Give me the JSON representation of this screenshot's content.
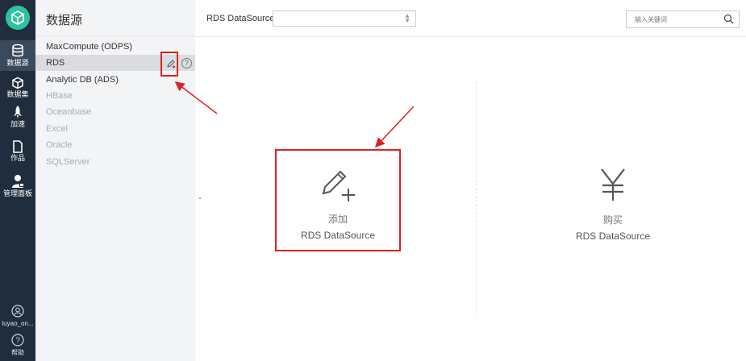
{
  "rail": {
    "items": [
      {
        "label": "数据源",
        "icon": "database-icon",
        "active": true
      },
      {
        "label": "数据集",
        "icon": "cube-icon"
      },
      {
        "label": "加速",
        "icon": "rocket-icon"
      },
      {
        "label": "作品",
        "icon": "document-icon"
      },
      {
        "label": "管理面板",
        "icon": "admin-user-icon"
      }
    ],
    "user": "luyao_on...",
    "help": "帮助"
  },
  "panel": {
    "title": "数据源",
    "items": [
      {
        "label": "MaxCompute (ODPS)",
        "state": "enabled"
      },
      {
        "label": "RDS",
        "state": "selected"
      },
      {
        "label": "Analytic DB (ADS)",
        "state": "enabled"
      },
      {
        "label": "HBase",
        "state": "disabled"
      },
      {
        "label": "Oceanbase",
        "state": "disabled"
      },
      {
        "label": "Excel",
        "state": "disabled"
      },
      {
        "label": "Oracle",
        "state": "disabled"
      },
      {
        "label": "SQLServer",
        "state": "disabled"
      }
    ]
  },
  "toolbar": {
    "label": "RDS DataSource",
    "select_value": "",
    "search_placeholder": "输入关键词"
  },
  "cards": {
    "add": {
      "line1": "添加",
      "line2": "RDS DataSource",
      "icon": "pencil-plus-icon"
    },
    "buy": {
      "line1": "购买",
      "line2": "RDS DataSource",
      "icon": "yen-icon"
    }
  },
  "colors": {
    "rail_bg": "#1f2d3d",
    "logo": "#2ec2a0",
    "annotation": "#e02020"
  }
}
